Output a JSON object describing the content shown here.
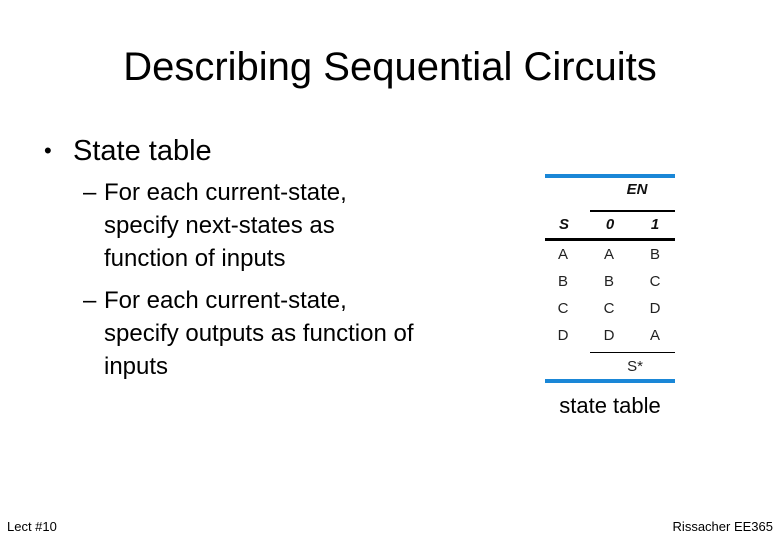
{
  "slide": {
    "title": "Describing Sequential Circuits",
    "bullet": {
      "marker": "•",
      "text": "State table",
      "sub_items": [
        {
          "marker": "–",
          "lines": [
            "For each current-state,",
            "specify next-states as",
            "function of inputs"
          ]
        },
        {
          "marker": "–",
          "lines": [
            "For each current-state,",
            "specify outputs as function of",
            "inputs"
          ]
        }
      ]
    },
    "state_table": {
      "input_label": "EN",
      "state_header": "S",
      "input_values": [
        "0",
        "1"
      ],
      "rows": [
        {
          "state": "A",
          "next": [
            "A",
            "B"
          ]
        },
        {
          "state": "B",
          "next": [
            "B",
            "C"
          ]
        },
        {
          "state": "C",
          "next": [
            "C",
            "D"
          ]
        },
        {
          "state": "D",
          "next": [
            "D",
            "A"
          ]
        }
      ],
      "next_state_label": "S*",
      "accent_color": "#1a87d7"
    },
    "caption": "state table",
    "footer": {
      "left": "Lect #10",
      "right": "Rissacher EE365"
    }
  }
}
